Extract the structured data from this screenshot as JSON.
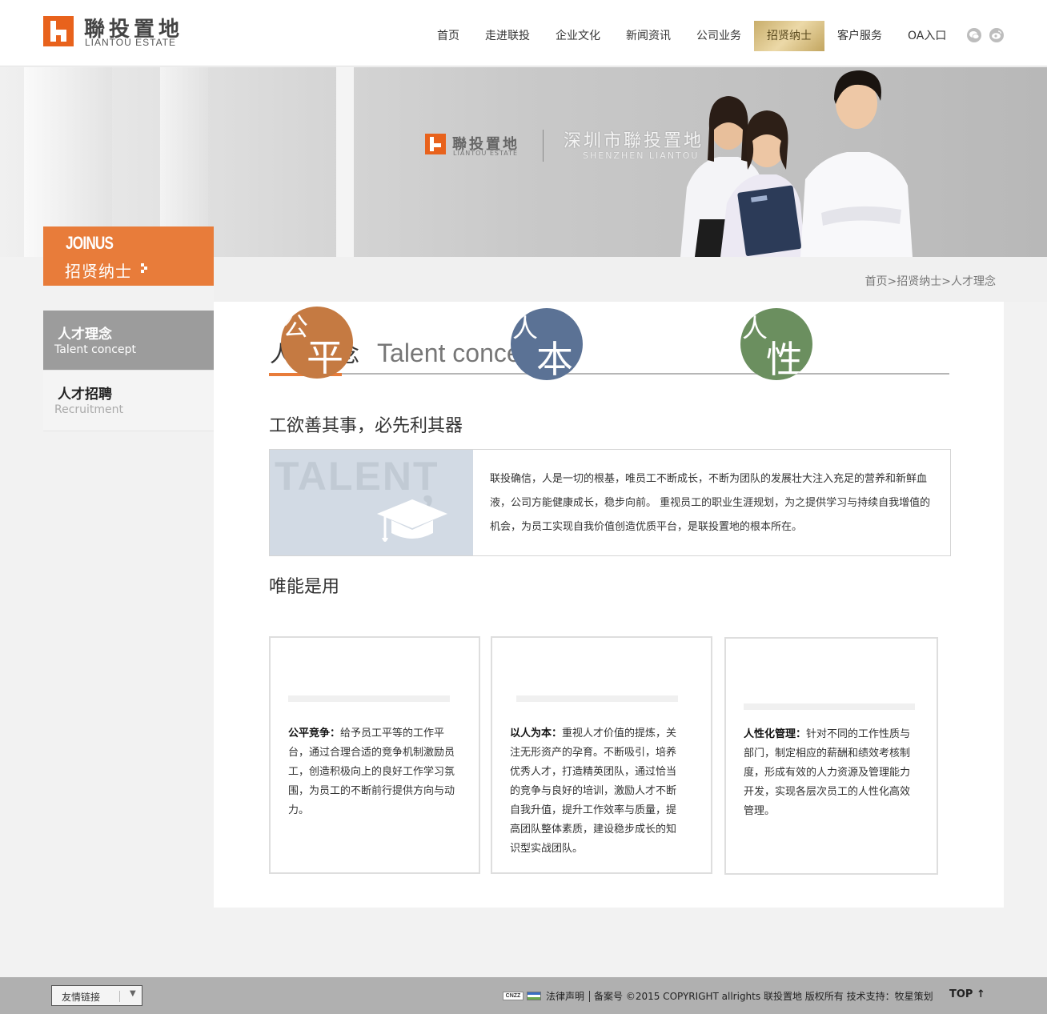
{
  "header": {
    "logo_cn": "聯投置地",
    "logo_en": "LIANTOU ESTATE",
    "nav": [
      {
        "label": "首页"
      },
      {
        "label": "走进联投"
      },
      {
        "label": "企业文化"
      },
      {
        "label": "新闻资讯"
      },
      {
        "label": "公司业务"
      },
      {
        "label": "招贤纳士"
      },
      {
        "label": "客户服务"
      },
      {
        "label": "OA入口"
      }
    ],
    "active_nav": "招贤纳士",
    "icons": [
      "wechat-icon",
      "weibo-icon"
    ]
  },
  "banner": {
    "brand_cn": "聯投置地",
    "brand_en": "LIANTOU ESTATE",
    "company_cn": "深圳市聯投置地",
    "company_en": "SHENZHEN LIANTOU"
  },
  "joinus": {
    "en": "JOINUS",
    "cn": "招贤纳士"
  },
  "breadcrumb": {
    "home": "首页",
    "sep1": ">",
    "section": "招贤纳士",
    "sep2": ">",
    "current": "人才理念"
  },
  "side_menu": [
    {
      "cn": "人才理念",
      "en": "Talent concept",
      "active": true
    },
    {
      "cn": "人才招聘",
      "en": "Recruitment",
      "active": false
    }
  ],
  "content": {
    "title_cn": "人才理念",
    "title_en": "Talent concept",
    "slogan": "工欲善其事，必先利其器",
    "talent_word": "TALENT",
    "talent_comma": ",",
    "intro": "联投确信，人是一切的根基，唯员工不断成长，不断为团队的发展壮大注入充足的营养和新鲜血液，公司方能健康成长，稳步向前。 重视员工的职业生涯规划，为之提供学习与持续自我增值的机会，为员工实现自我价值创造优质平台，是联投置地的根本所在。",
    "subtitle": "唯能是用",
    "cards": [
      {
        "char_small": "公",
        "char_big": "平",
        "circle_color": "#c57a42",
        "heading": "公平竞争：",
        "text": "给予员工平等的工作平台，通过合理合适的竞争机制激励员工，创造积极向上的良好工作学习氛围，为员工的不断前行提供方向与动力。"
      },
      {
        "char_small": "人",
        "char_big": "本",
        "circle_color": "#5b7295",
        "heading": "以人为本：",
        "text": "重视人才价值的提炼，关注无形资产的孕育。不断吸引，培养优秀人才，打造精英团队，通过恰当的竞争与良好的培训，激励人才不断自我升值，提升工作效率与质量，提高团队整体素质，建设稳步成长的知识型实战团队。"
      },
      {
        "char_small": "人",
        "char_big": "性",
        "circle_color": "#6b8f5f",
        "heading": "人性化管理：",
        "text": "针对不同的工作性质与部门，制定相应的薪酬和绩效考核制度，形成有效的人力资源及管理能力开发，实现各层次员工的人性化高效管理。"
      }
    ]
  },
  "footer": {
    "friend_links": "友情链接",
    "cnzz": "CNZZ",
    "legal": "法律声明",
    "copyright": "备案号 ©2015 COPYRIGHT allrights 联投置地 版权所有 技术支持：牧星策划",
    "top": "TOP ↑"
  },
  "colors": {
    "accent": "#e87c3a",
    "nav_active": "#d9c38a",
    "side_active": "#9c9c9c"
  }
}
